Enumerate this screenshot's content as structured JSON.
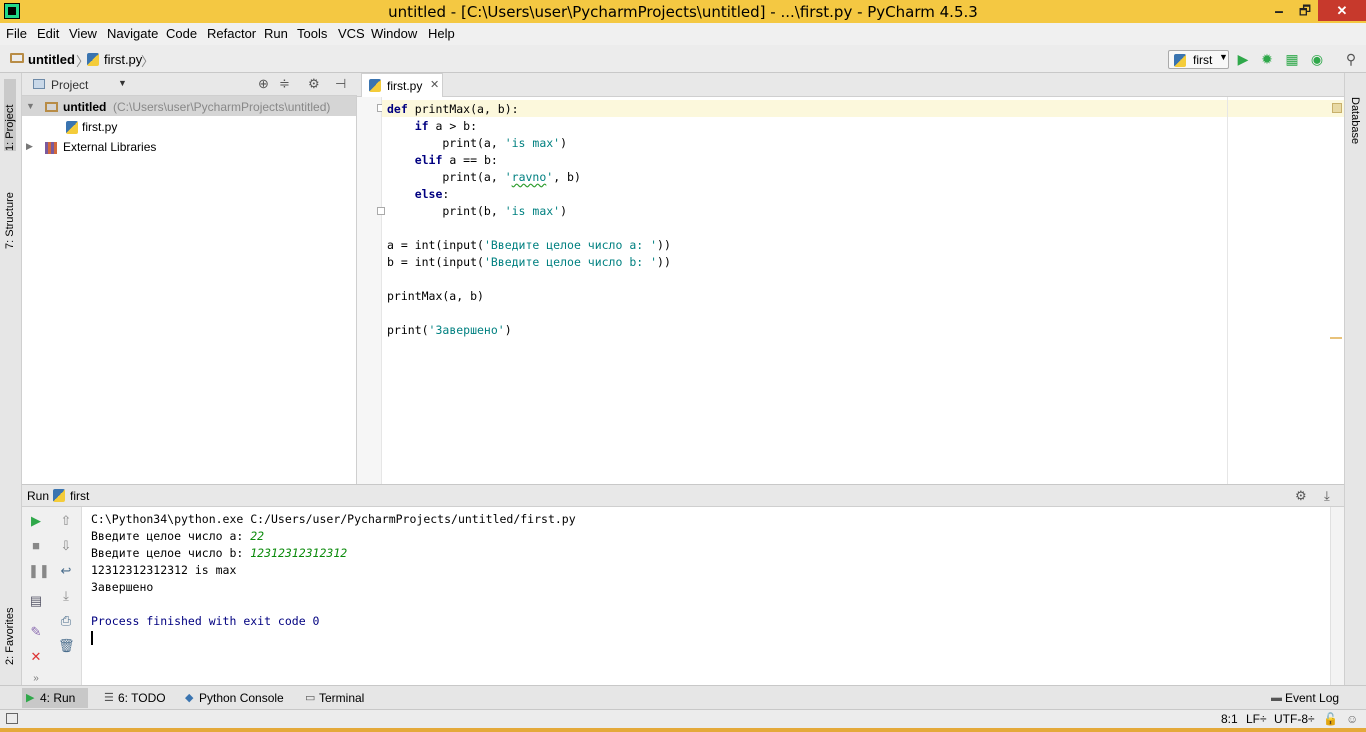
{
  "window": {
    "title": "untitled - [C:\\Users\\user\\PycharmProjects\\untitled] - ...\\first.py - PyCharm 4.5.3",
    "minimize": "🗕",
    "maximize": "🗗",
    "close": "✕"
  },
  "menu": [
    "File",
    "Edit",
    "View",
    "Navigate",
    "Code",
    "Refactor",
    "Run",
    "Tools",
    "VCS",
    "Window",
    "Help"
  ],
  "navbar": {
    "project": "untitled",
    "file": "first.py",
    "run_config": "first"
  },
  "left_strip": {
    "project_tab": "1: Project",
    "structure_tab": "7: Structure",
    "favorites_tab": "2: Favorites"
  },
  "right_strip": {
    "database_tab": "Database"
  },
  "project_panel": {
    "view": "Project",
    "root_name": "untitled",
    "root_path": "(C:\\Users\\user\\PycharmProjects\\untitled)",
    "file": "first.py",
    "libs": "External Libraries"
  },
  "editor": {
    "tab": "first.py",
    "lines": [
      "def printMax(a, b):",
      "    if a > b:",
      "        print(a, 'is max')",
      "    elif a == b:",
      "        print(a, 'ravno', b)",
      "    else:",
      "        print(b, 'is max')",
      "",
      "a = int(input('Введите целое число a: '))",
      "b = int(input('Введите целое число b: '))",
      "",
      "printMax(a, b)",
      "",
      "print('Завершено')"
    ]
  },
  "run_panel": {
    "label": "Run",
    "config": "first",
    "console": {
      "command": "C:\\Python34\\python.exe C:/Users/user/PycharmProjects/untitled/first.py",
      "prompt_a": "Введите целое число a: ",
      "input_a": "22",
      "prompt_b": "Введите целое число b: ",
      "input_b": "12312312312312",
      "result": "12312312312312 is max",
      "done": "Завершено",
      "exit": "Process finished with exit code 0"
    }
  },
  "bottom_tabs": {
    "run": "4: Run",
    "todo": "6: TODO",
    "python_console": "Python Console",
    "terminal": "Terminal",
    "event_log": "Event Log"
  },
  "status": {
    "position": "8:1",
    "line_sep": "LF÷",
    "encoding": "UTF-8÷"
  }
}
